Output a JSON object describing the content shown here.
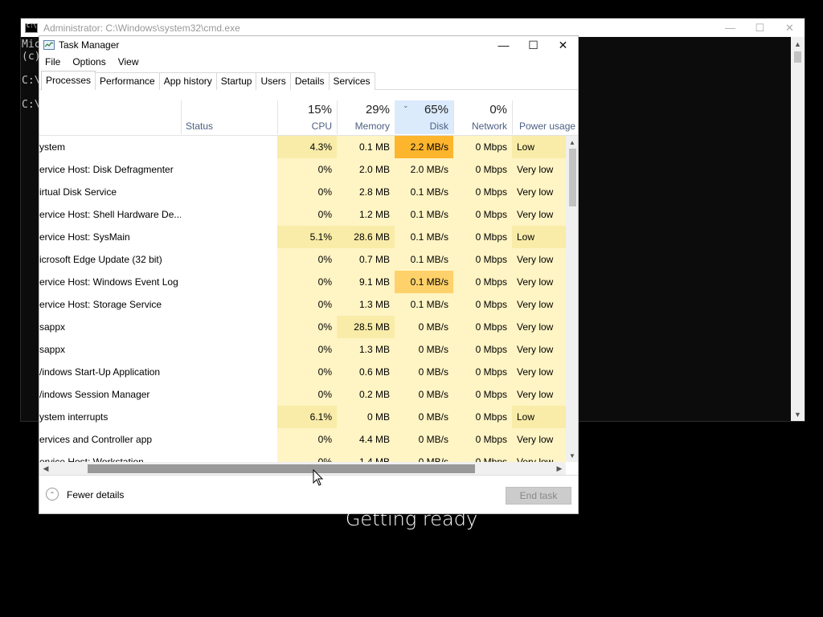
{
  "colors": {
    "heat_1": "#fff4c4",
    "heat_2": "#f9eca8",
    "heat_3": "#ffd16a",
    "heat_4": "#fdb52d",
    "sorted_header": "#dcebfc"
  },
  "cmd": {
    "title": "Administrator: C:\\Windows\\system32\\cmd.exe",
    "lines": [
      "Mic",
      "(c)",
      "",
      "C:\\",
      "",
      "C:\\"
    ]
  },
  "taskmanager": {
    "title": "Task Manager",
    "menu": [
      "File",
      "Options",
      "View"
    ],
    "tabs": [
      "Processes",
      "Performance",
      "App history",
      "Startup",
      "Users",
      "Details",
      "Services"
    ],
    "active_tab": "Processes",
    "columns": {
      "status": {
        "label": "Status"
      },
      "cpu": {
        "pct": "15%",
        "label": "CPU"
      },
      "memory": {
        "pct": "29%",
        "label": "Memory"
      },
      "disk": {
        "pct": "65%",
        "label": "Disk"
      },
      "network": {
        "pct": "0%",
        "label": "Network"
      },
      "power": {
        "label": "Power usage"
      }
    },
    "processes": [
      {
        "name": "ystem",
        "cpu": "4.3%",
        "memory": "0.1 MB",
        "disk": "2.2 MB/s",
        "network": "0 Mbps",
        "power": "Low",
        "cpu_heat": 2,
        "mem_heat": 1,
        "disk_heat": 4,
        "pow_heat": 2
      },
      {
        "name": "ervice Host: Disk Defragmenter",
        "cpu": "0%",
        "memory": "2.0 MB",
        "disk": "2.0 MB/s",
        "network": "0 Mbps",
        "power": "Very low",
        "cpu_heat": 1,
        "mem_heat": 1,
        "disk_heat": 1,
        "pow_heat": 1
      },
      {
        "name": "irtual Disk Service",
        "cpu": "0%",
        "memory": "2.8 MB",
        "disk": "0.1 MB/s",
        "network": "0 Mbps",
        "power": "Very low",
        "cpu_heat": 1,
        "mem_heat": 1,
        "disk_heat": 1,
        "pow_heat": 1
      },
      {
        "name": "ervice Host: Shell Hardware De...",
        "cpu": "0%",
        "memory": "1.2 MB",
        "disk": "0.1 MB/s",
        "network": "0 Mbps",
        "power": "Very low",
        "cpu_heat": 1,
        "mem_heat": 1,
        "disk_heat": 1,
        "pow_heat": 1
      },
      {
        "name": "ervice Host: SysMain",
        "cpu": "5.1%",
        "memory": "28.6 MB",
        "disk": "0.1 MB/s",
        "network": "0 Mbps",
        "power": "Low",
        "cpu_heat": 2,
        "mem_heat": 2,
        "disk_heat": 1,
        "pow_heat": 2
      },
      {
        "name": "icrosoft Edge Update (32 bit)",
        "cpu": "0%",
        "memory": "0.7 MB",
        "disk": "0.1 MB/s",
        "network": "0 Mbps",
        "power": "Very low",
        "cpu_heat": 1,
        "mem_heat": 1,
        "disk_heat": 1,
        "pow_heat": 1
      },
      {
        "name": "ervice Host: Windows Event Log",
        "cpu": "0%",
        "memory": "9.1 MB",
        "disk": "0.1 MB/s",
        "network": "0 Mbps",
        "power": "Very low",
        "cpu_heat": 1,
        "mem_heat": 1,
        "disk_heat": 3,
        "pow_heat": 1
      },
      {
        "name": "ervice Host: Storage Service",
        "cpu": "0%",
        "memory": "1.3 MB",
        "disk": "0.1 MB/s",
        "network": "0 Mbps",
        "power": "Very low",
        "cpu_heat": 1,
        "mem_heat": 1,
        "disk_heat": 1,
        "pow_heat": 1
      },
      {
        "name": "sappx",
        "cpu": "0%",
        "memory": "28.5 MB",
        "disk": "0 MB/s",
        "network": "0 Mbps",
        "power": "Very low",
        "cpu_heat": 1,
        "mem_heat": 2,
        "disk_heat": 1,
        "pow_heat": 1
      },
      {
        "name": "sappx",
        "cpu": "0%",
        "memory": "1.3 MB",
        "disk": "0 MB/s",
        "network": "0 Mbps",
        "power": "Very low",
        "cpu_heat": 1,
        "mem_heat": 1,
        "disk_heat": 1,
        "pow_heat": 1
      },
      {
        "name": "/indows Start-Up Application",
        "cpu": "0%",
        "memory": "0.6 MB",
        "disk": "0 MB/s",
        "network": "0 Mbps",
        "power": "Very low",
        "cpu_heat": 1,
        "mem_heat": 1,
        "disk_heat": 1,
        "pow_heat": 1
      },
      {
        "name": "/indows Session Manager",
        "cpu": "0%",
        "memory": "0.2 MB",
        "disk": "0 MB/s",
        "network": "0 Mbps",
        "power": "Very low",
        "cpu_heat": 1,
        "mem_heat": 1,
        "disk_heat": 1,
        "pow_heat": 1
      },
      {
        "name": "ystem interrupts",
        "cpu": "6.1%",
        "memory": "0 MB",
        "disk": "0 MB/s",
        "network": "0 Mbps",
        "power": "Low",
        "cpu_heat": 2,
        "mem_heat": 1,
        "disk_heat": 1,
        "pow_heat": 2
      },
      {
        "name": "ervices and Controller app",
        "cpu": "0%",
        "memory": "4.4 MB",
        "disk": "0 MB/s",
        "network": "0 Mbps",
        "power": "Very low",
        "cpu_heat": 1,
        "mem_heat": 1,
        "disk_heat": 1,
        "pow_heat": 1
      },
      {
        "name": "ervice Host: Workstation",
        "cpu": "0%",
        "memory": "1.4 MB",
        "disk": "0 MB/s",
        "network": "0 Mbps",
        "power": "Very low",
        "cpu_heat": 1,
        "mem_heat": 1,
        "disk_heat": 1,
        "pow_heat": 1
      }
    ],
    "footer": {
      "fewer_details": "Fewer details",
      "end_task": "End task"
    }
  },
  "status_text": "Getting ready"
}
